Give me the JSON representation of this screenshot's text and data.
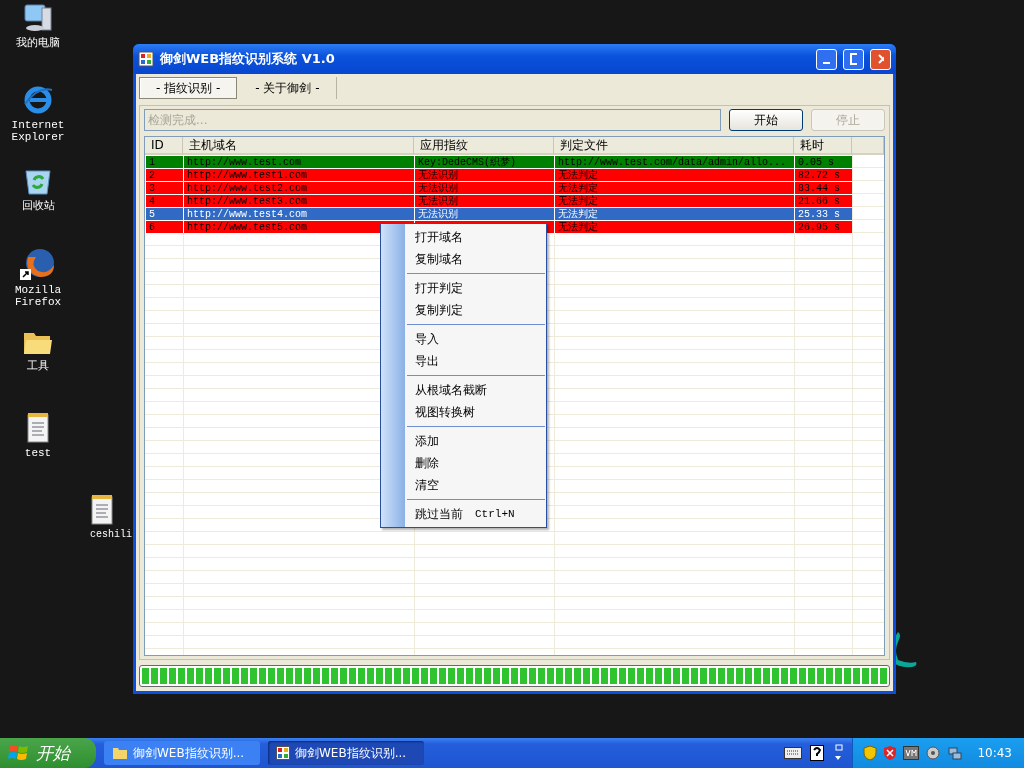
{
  "desktop_icons": [
    {
      "label": "我的电脑",
      "kind": "computer"
    },
    {
      "label": "Internet Explorer",
      "kind": "browser"
    },
    {
      "label": "回收站",
      "kind": "bin"
    },
    {
      "label": "Mozilla Firefox",
      "kind": "fox"
    },
    {
      "label": "工具",
      "kind": "folder"
    },
    {
      "label": "test",
      "kind": "note"
    },
    {
      "label": "ceshili",
      "kind": "note"
    }
  ],
  "window": {
    "title": "御剑WEB指纹识别系统 V1.0",
    "tabs": [
      {
        "label": "- 指纹识别 -",
        "selected": true
      },
      {
        "label": "- 关于御剑 -",
        "selected": false
      }
    ],
    "status_field": {
      "placeholder": "检测完成..."
    },
    "buttons": [
      {
        "label": "开始",
        "disabled": false
      },
      {
        "label": "停止",
        "disabled": true
      }
    ],
    "table": {
      "columns": [
        "ID",
        "主机域名",
        "应用指纹",
        "判定文件",
        "耗时"
      ],
      "rows": [
        {
          "id": "1",
          "host": "http://www.test.com",
          "fingerprint": "Key:DedeCMS(织梦)",
          "file": "http://www.test.com/data/admin/allo...",
          "time": "0.05 s",
          "color": "#008000",
          "selected": false
        },
        {
          "id": "2",
          "host": "http://www.test1.com",
          "fingerprint": "无法识别",
          "file": "无法判定",
          "time": "82.72 s",
          "color": "#ff0000",
          "selected": false
        },
        {
          "id": "3",
          "host": "http://www.test2.com",
          "fingerprint": "无法识别",
          "file": "无法判定",
          "time": "83.44 s",
          "color": "#ff0000",
          "selected": false
        },
        {
          "id": "4",
          "host": "http://www.test3.com",
          "fingerprint": "无法识别",
          "file": "无法判定",
          "time": "21.66 s",
          "color": "#ff0000",
          "selected": false
        },
        {
          "id": "5",
          "host": "http://www.test4.com",
          "fingerprint": "无法识别",
          "file": "无法判定",
          "time": "25.33 s",
          "color": "#316ac5",
          "selected": true
        },
        {
          "id": "6",
          "host": "http://www.test5.com",
          "file": "无法判定",
          "time": "26.95 s",
          "color": "#ff0000",
          "selected": false
        }
      ]
    },
    "progress": {
      "level": 1
    },
    "context_menu": [
      [
        {
          "label": "打开域名"
        },
        {
          "label": "复制域名"
        }
      ],
      [
        {
          "label": "打开判定"
        },
        {
          "label": "复制判定"
        }
      ],
      [
        {
          "label": "导入"
        },
        {
          "label": "导出"
        }
      ],
      [
        {
          "label": "从根域名截断"
        },
        {
          "label": "视图转换树"
        }
      ],
      [
        {
          "label": "添加"
        },
        {
          "label": "删除"
        },
        {
          "label": "清空"
        }
      ],
      [
        {
          "label": "跳过当前",
          "shortcut": "Ctrl+N"
        }
      ]
    ]
  },
  "taskbar": {
    "start": "开始",
    "tasks": [
      {
        "label": "御剑WEB指纹识别...",
        "kind": "folder",
        "selected": false
      },
      {
        "label": "御剑WEB指纹识别...",
        "kind": "app",
        "selected": true
      }
    ],
    "clock": "10:43"
  }
}
